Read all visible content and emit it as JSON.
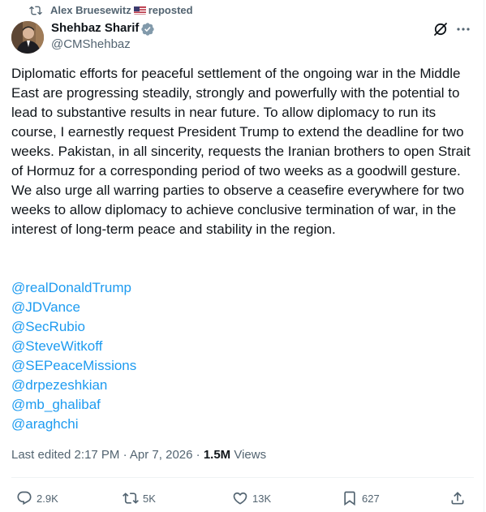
{
  "repost": {
    "user": "Alex Bruesewitz",
    "label": "reposted"
  },
  "author": {
    "name": "Shehbaz Sharif",
    "handle": "@CMShehbaz"
  },
  "tweet": {
    "text": "Diplomatic efforts for peaceful settlement of the ongoing war in the Middle East are progressing steadily, strongly and powerfully with the potential to lead to substantive results in near future. To allow diplomacy to run its course, I earnestly request President Trump to extend the deadline for two weeks. Pakistan, in all sincerity, requests the Iranian brothers to open Strait of Hormuz for a corresponding period of two weeks as a goodwill gesture. We also urge all warring parties to observe a ceasefire everywhere for two weeks to allow diplomacy to achieve conclusive termination of war, in the interest of long-term peace and stability in the region.",
    "mentions": [
      "@realDonaldTrump",
      "@JDVance",
      "@SecRubio",
      "@SteveWitkoff",
      "@SEPeaceMissions",
      "@drpezeshkian",
      "@mb_ghalibaf",
      "@araghchi"
    ]
  },
  "meta": {
    "edited": "Last edited 2:17 PM · Apr 7, 2026 · ",
    "views_count": "1.5M",
    "views_label": " Views"
  },
  "actions": {
    "replies": "2.9K",
    "reposts": "5K",
    "likes": "13K",
    "bookmarks": "627"
  },
  "icons": [
    "repost-icon",
    "us-flag-icon",
    "verified-badge-icon",
    "grok-icon",
    "more-icon",
    "reply-icon",
    "like-icon",
    "bookmark-icon",
    "share-icon"
  ],
  "colors": {
    "text": "#0f1419",
    "secondary": "#536471",
    "link": "#1d9bf0",
    "divider": "#eff3f4"
  }
}
